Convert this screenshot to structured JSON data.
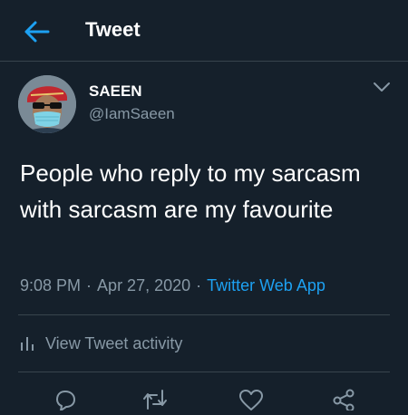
{
  "header": {
    "title": "Tweet",
    "back_icon": "arrow-left-icon"
  },
  "tweet": {
    "author": {
      "name": "SAEEN",
      "handle": "@IamSaeen"
    },
    "text": "People who reply to my sarcasm with sarcasm are my favourite",
    "time": "9:08 PM",
    "date": "Apr 27, 2020",
    "separator": "·",
    "client": "Twitter Web App"
  },
  "activity": {
    "label": "View Tweet activity",
    "icon": "bar-chart-icon"
  },
  "actions": {
    "icons": [
      "reply-icon",
      "retweet-icon",
      "like-icon",
      "share-icon"
    ]
  },
  "colors": {
    "background": "#15202b",
    "accent": "#1da1f2",
    "secondary_text": "#8899a6",
    "divider": "#38444d"
  }
}
